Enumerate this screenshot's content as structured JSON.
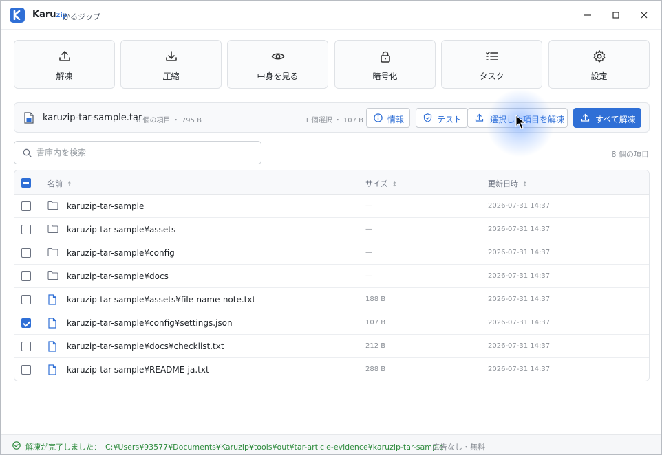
{
  "app": {
    "title": "Karu",
    "title_suffix": "zip",
    "subtitle": "かるジップ",
    "brand_color": "#2f6fd6"
  },
  "toolbar": [
    {
      "key": "extract",
      "label": "解凍",
      "icon": "upload-icon"
    },
    {
      "key": "compress",
      "label": "圧縮",
      "icon": "download-icon"
    },
    {
      "key": "view",
      "label": "中身を見る",
      "icon": "eye-icon"
    },
    {
      "key": "encrypt",
      "label": "暗号化",
      "icon": "lock-icon"
    },
    {
      "key": "tasks",
      "label": "タスク",
      "icon": "list-icon"
    },
    {
      "key": "settings",
      "label": "設定",
      "icon": "gear-icon"
    }
  ],
  "archive": {
    "name": "karuzip-tar-sample.tar",
    "meta": "8 個の項目 ・ 795 B",
    "selection": "1 個選択 ・ 107 B",
    "info_label": "情報",
    "test_label": "テスト",
    "extract_selected_label": "選択した項目を解凍",
    "extract_all_label": "すべて解凍"
  },
  "search": {
    "placeholder": "書庫内を検索",
    "value": ""
  },
  "item_count": "8 個の項目",
  "table": {
    "columns": {
      "name": "名前",
      "size": "サイズ",
      "date": "更新日時"
    },
    "name_sort": "↑",
    "size_sort": "↕",
    "date_sort": "↕",
    "rows": [
      {
        "type": "folder",
        "name": "karuzip-tar-sample",
        "size": "—",
        "date": "2026-07-31 14:37",
        "checked": false
      },
      {
        "type": "folder",
        "name": "karuzip-tar-sample¥assets",
        "size": "—",
        "date": "2026-07-31 14:37",
        "checked": false
      },
      {
        "type": "folder",
        "name": "karuzip-tar-sample¥config",
        "size": "—",
        "date": "2026-07-31 14:37",
        "checked": false
      },
      {
        "type": "folder",
        "name": "karuzip-tar-sample¥docs",
        "size": "—",
        "date": "2026-07-31 14:37",
        "checked": false
      },
      {
        "type": "file",
        "name": "karuzip-tar-sample¥assets¥file-name-note.txt",
        "size": "188 B",
        "date": "2026-07-31 14:37",
        "checked": false
      },
      {
        "type": "file",
        "name": "karuzip-tar-sample¥config¥settings.json",
        "size": "107 B",
        "date": "2026-07-31 14:37",
        "checked": true
      },
      {
        "type": "file",
        "name": "karuzip-tar-sample¥docs¥checklist.txt",
        "size": "212 B",
        "date": "2026-07-31 14:37",
        "checked": false
      },
      {
        "type": "file",
        "name": "karuzip-tar-sample¥README-ja.txt",
        "size": "288 B",
        "date": "2026-07-31 14:37",
        "checked": false
      }
    ]
  },
  "status": {
    "message": "解凍が完了しました：",
    "path": "C:¥Users¥93577¥Documents¥Karuzip¥tools¥out¥tar-article-evidence¥karuzip-tar-sample",
    "separator": "·",
    "ad_text": "広告なし・無料",
    "success_color": "#2e8b3d"
  }
}
